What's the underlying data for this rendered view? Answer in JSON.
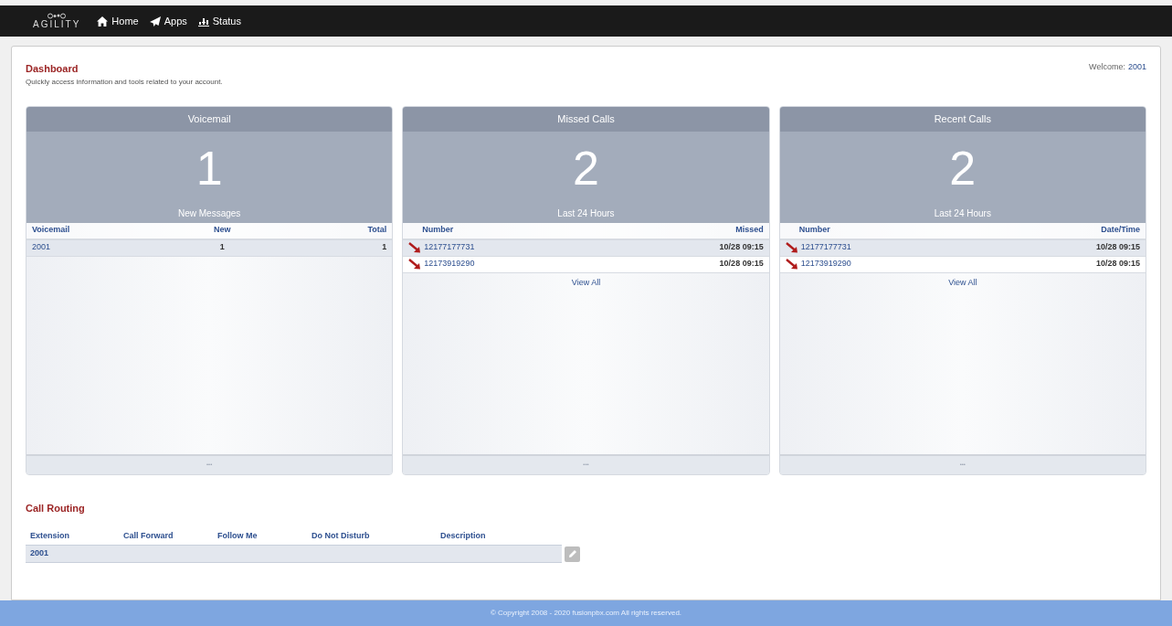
{
  "nav": {
    "logo": "AGILITY",
    "items": [
      {
        "label": "Home"
      },
      {
        "label": "Apps"
      },
      {
        "label": "Status"
      }
    ]
  },
  "header": {
    "title": "Dashboard",
    "subtitle": "Quickly access information and tools related to your account.",
    "welcome_label": "Welcome:",
    "welcome_user": "2001"
  },
  "panels": [
    {
      "title": "Voicemail",
      "count": "1",
      "caption": "New Messages",
      "columns": [
        "Voicemail",
        "New",
        "Total"
      ],
      "rows": [
        {
          "kind": "mailbox",
          "cells": [
            "2001",
            "1",
            "1"
          ]
        }
      ],
      "footer": "•••"
    },
    {
      "title": "Missed Calls",
      "count": "2",
      "caption": "Last 24 Hours",
      "columns": [
        "Number",
        "Missed"
      ],
      "rows": [
        {
          "kind": "call",
          "cells": [
            "12177177731",
            "10/28 09:15"
          ]
        },
        {
          "kind": "call",
          "cells": [
            "12173919290",
            "10/28 09:15"
          ]
        }
      ],
      "view_all": "View All",
      "footer": "•••"
    },
    {
      "title": "Recent Calls",
      "count": "2",
      "caption": "Last 24 Hours",
      "columns": [
        "Number",
        "Date/Time"
      ],
      "rows": [
        {
          "kind": "call",
          "cells": [
            "12177177731",
            "10/28 09:15"
          ]
        },
        {
          "kind": "call",
          "cells": [
            "12173919290",
            "10/28 09:15"
          ]
        }
      ],
      "view_all": "View All",
      "footer": "•••"
    }
  ],
  "call_routing": {
    "title": "Call Routing",
    "columns": [
      "Extension",
      "Call Forward",
      "Follow Me",
      "Do Not Disturb",
      "Description"
    ],
    "rows": [
      {
        "cells": [
          "2001"
        ]
      }
    ]
  },
  "footer": "© Copyright 2008 - 2020 fusionpbx.com All rights reserved."
}
